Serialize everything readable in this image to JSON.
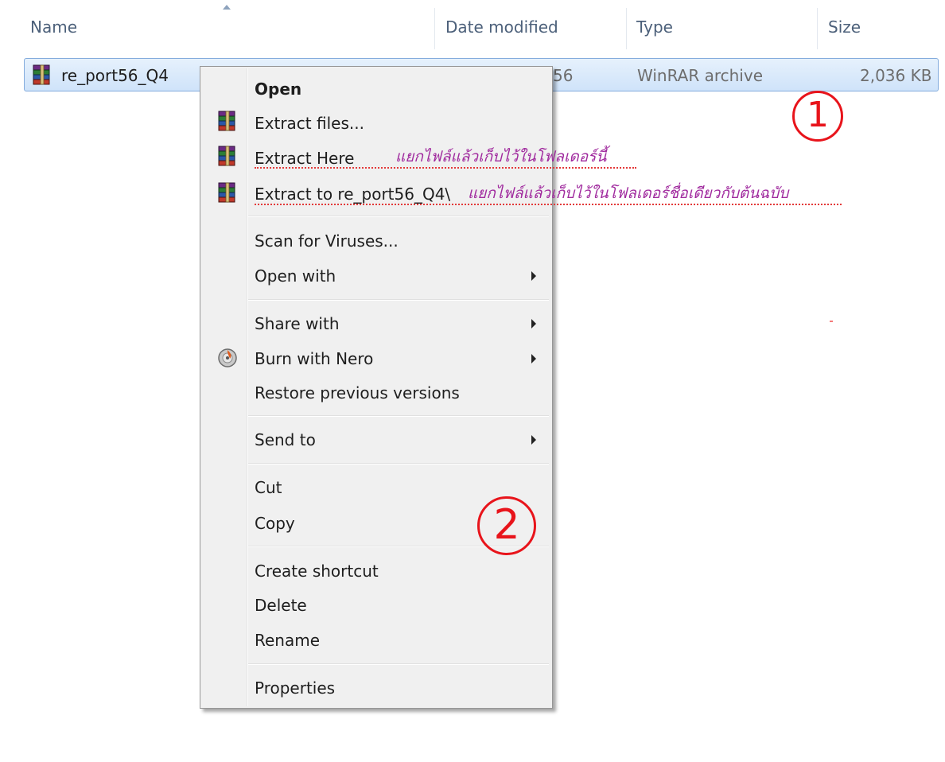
{
  "columns": {
    "name": "Name",
    "date_modified": "Date modified",
    "type": "Type",
    "size": "Size"
  },
  "file": {
    "name": "re_port56_Q4",
    "date_fragment": "56",
    "type": "WinRAR archive",
    "size": "2,036 KB",
    "icon": "winrar-archive-icon"
  },
  "annotations": {
    "circle_1": "①",
    "circle_2": "②",
    "note_extract_here": "แยกไฟล์แล้วเก็บไว้ในโฟลเดอร์นี้",
    "note_extract_to": "แยกไฟล์แล้วเก็บไว้ในโฟลเดอร์ชื่อเดียวกับต้นฉบับ"
  },
  "context_menu": {
    "open": "Open",
    "extract_files": "Extract files...",
    "extract_here": "Extract Here",
    "extract_to": "Extract to re_port56_Q4\\",
    "scan_viruses": "Scan for Viruses...",
    "open_with": "Open with",
    "share_with": "Share with",
    "burn_with_nero": "Burn with Nero",
    "restore_previous": "Restore previous versions",
    "send_to": "Send to",
    "cut": "Cut",
    "copy": "Copy",
    "create_shortcut": "Create shortcut",
    "delete": "Delete",
    "rename": "Rename",
    "properties": "Properties"
  },
  "colors": {
    "annotation_red": "#e8141b",
    "annotation_purple": "#a02a9e",
    "selection_border": "#84acdd"
  }
}
